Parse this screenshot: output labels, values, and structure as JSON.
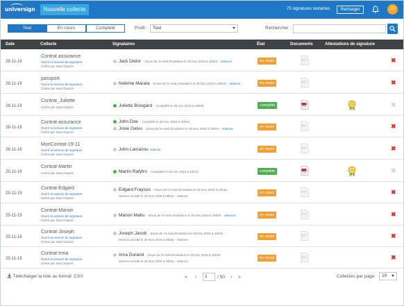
{
  "header": {
    "logo_text": "universign",
    "new_button": "Nouvelle collecte",
    "remaining": "75 signatures restantes",
    "recharge_button": "Recharger",
    "avatar_initials": "JD",
    "brand_color": "#1f78c7",
    "accent_color": "#3aa7e0",
    "avatar_color": "#f5a623"
  },
  "filters": {
    "tabs": [
      "Tout",
      "En cours",
      "Complété"
    ],
    "active_tab": "Tout",
    "profil_label": "Profil :",
    "profil_value": "Tout",
    "search_label": "Rechercher :",
    "search_value": ""
  },
  "table": {
    "columns": [
      "Date",
      "Collecte",
      "Signataires",
      "État",
      "Documents",
      "Attestations de signature"
    ],
    "rows": [
      {
        "date": "28-11-19",
        "title": "Contrat assurance",
        "link": "Ouvrir la session de signature",
        "author": "Créée par Jean Dupont",
        "signers": [
          {
            "name": "Jack Dielor",
            "detail": "- Envoi de l'e-mail d'invitation le 28 Nov 2019 à 16h23 -",
            "action": "relancer",
            "status": "pending"
          }
        ],
        "state": "en cours",
        "state_type": "encours",
        "doc_signed": false,
        "attestation": false,
        "deletable": true
      },
      {
        "date": "28-11-19",
        "title": "passport",
        "link": "Ouvrir la session de signature",
        "author": "Créée par Jean Dupont",
        "signers": [
          {
            "name": "Noëmie Marata",
            "detail": "- Envoi de l'e-mail d'invitation le 28 Nov 2019 à 15h44 -",
            "action": "relancer",
            "status": "pending"
          }
        ],
        "state": "en cours",
        "state_type": "encours",
        "doc_signed": false,
        "attestation": false,
        "deletable": true
      },
      {
        "date": "26-11-19",
        "title": "Contrat_Juliette",
        "link": "",
        "author": "Créée par Jean Dupont",
        "signers": [
          {
            "name": "Juliette Boisgard",
            "detail": "- Complété le 26 nov. 2019 à 16h45",
            "action": "",
            "status": "done"
          }
        ],
        "state": "complète",
        "state_type": "complete",
        "doc_signed": true,
        "attestation": true,
        "deletable": false
      },
      {
        "date": "26-11-19",
        "title": "Contrat-assurance",
        "link": "Ouvrir la session de signature",
        "author": "Créée par Jean Dupont",
        "signers": [
          {
            "name": "John Doe",
            "detail": "- Complété le 26 nov. 2019 à 10h44",
            "action": "",
            "status": "done"
          },
          {
            "name": "Josie Galvu",
            "detail": "- Envoi de l'e-mail d'invitation le 26 Nov 2019 à 10h44 -",
            "action": "relancer",
            "status": "pending"
          }
        ],
        "state": "en cours",
        "state_type": "encours",
        "doc_signed": false,
        "attestation": false,
        "deletable": true
      },
      {
        "date": "26-11-19",
        "title": "MonContrat-19-11",
        "link": "Ouvrir la session de signature",
        "author": "Créée par Jean Dupont",
        "signers": [
          {
            "name": "John Lamazou",
            "detail": "",
            "action": "relancer",
            "status": "pending"
          }
        ],
        "state": "en cours",
        "state_type": "encours",
        "doc_signed": false,
        "attestation": false,
        "deletable": true
      },
      {
        "date": "25-11-19",
        "title": "Contrat-Martin",
        "link": "",
        "author": "Créée par Jean Dupont",
        "signers": [
          {
            "name": "Martin Rafytro",
            "detail": "- Complété le 25 nov. 2019 à 16h13",
            "action": "",
            "status": "done"
          }
        ],
        "state": "complète",
        "state_type": "complete",
        "doc_signed": true,
        "attestation": true,
        "deletable": false
      },
      {
        "date": "25-11-19",
        "title": "Contrat-Edgard",
        "link": "Ouvrir la session de signature",
        "author": "Créée par Jean Dupont",
        "signers": [
          {
            "name": "Edgard Frayssо",
            "detail": "- Envoi de l'e-mail d'invitation le 25 Nov 2019 à 15h16 -",
            "action": "",
            "status": "pending",
            "extra": "Service accédé le 25 Nov 2019 à 09h54 - relancer"
          }
        ],
        "state": "en cours",
        "state_type": "encours",
        "doc_signed": false,
        "attestation": false,
        "deletable": true
      },
      {
        "date": "25-11-19",
        "title": "Contrat-Marion",
        "link": "Ouvrir la session de signature",
        "author": "Créée par Jean Dupont",
        "signers": [
          {
            "name": "Marion Mallu",
            "detail": "- Envoi de l'e-mail d'invitation le 25 Nov 2019 à 15h00 -",
            "action": "relancer",
            "status": "pending"
          }
        ],
        "state": "en cours",
        "state_type": "encours",
        "doc_signed": false,
        "attestation": false,
        "deletable": true
      },
      {
        "date": "25-11-19",
        "title": "Contrat-Joseph",
        "link": "Ouvrir la session de signature",
        "author": "Créée par Jean Dupont",
        "signers": [
          {
            "name": "Joseph Jacob",
            "detail": "- Envoi de l'e-mail d'invitation le 25 Nov 2019 à 16h46 -",
            "action": "",
            "status": "pending",
            "extra": "Service accédé le 25 Nov 2019 à 16h52 - relancer"
          }
        ],
        "state": "en cours",
        "state_type": "encours",
        "doc_signed": false,
        "attestation": false,
        "deletable": true
      },
      {
        "date": "25-11-19",
        "title": "Contrat-Irma",
        "link": "Ouvrir la session de signature",
        "author": "Créée par Jean Dupont",
        "signers": [
          {
            "name": "Irma Durand",
            "detail": "- Envoi de l'e-mail d'invitation le 25 Nov 2019 à 16h33 -",
            "action": "",
            "status": "pending",
            "extra": "Service accédé le 25 Nov 2019 à 16h41 - relancer"
          }
        ],
        "state": "en cours",
        "state_type": "encours",
        "doc_signed": false,
        "attestation": false,
        "deletable": true
      }
    ]
  },
  "footer": {
    "download": "Télécharger la liste au format .CSV",
    "page_current": "1",
    "page_total": "/ 50",
    "per_page_label": "Collectes par page:",
    "per_page_value": "10"
  },
  "colors": {
    "state_encours": "#f0a030",
    "state_complete": "#4caf50",
    "delete": "#d9342b",
    "table_header": "#3f4244"
  }
}
